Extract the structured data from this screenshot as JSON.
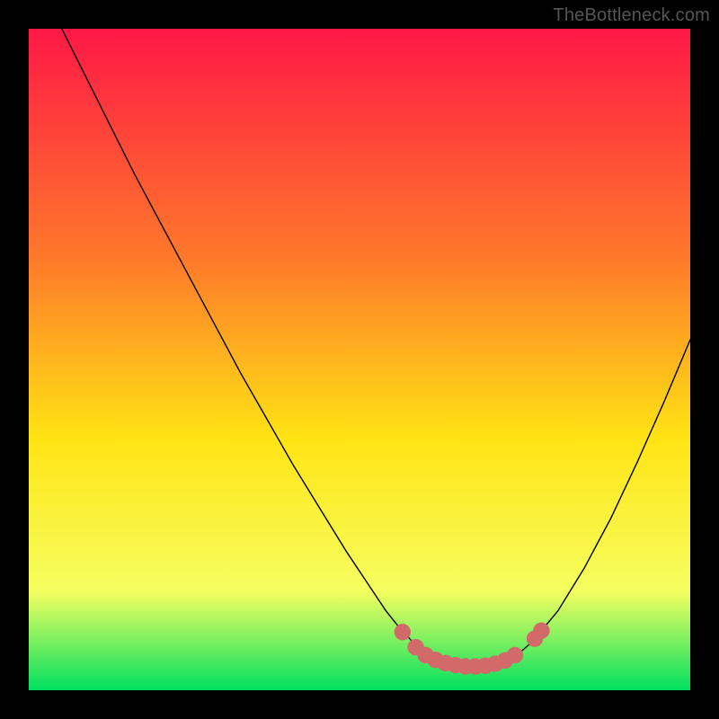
{
  "watermark": "TheBottleneck.com",
  "palette": {
    "gradient_top": "#ff1846",
    "gradient_upper_mid": "#ff7a2a",
    "gradient_mid": "#ffe414",
    "gradient_lower_mid": "#f6ff60",
    "gradient_bottom": "#00e060",
    "frame": "#000000",
    "curve": "#000000",
    "marker": "#d26a6a"
  },
  "chart_data": {
    "type": "line",
    "title": "",
    "xlabel": "",
    "ylabel": "",
    "xlim": [
      0,
      100
    ],
    "ylim": [
      0,
      100
    ],
    "x": [
      5,
      8,
      12,
      16,
      20,
      24,
      28,
      32,
      36,
      40,
      44,
      48,
      52,
      54,
      56,
      58.5,
      60,
      62,
      64,
      66,
      68,
      70,
      72,
      74,
      76,
      80,
      84,
      88,
      92,
      96,
      100
    ],
    "values": [
      100,
      94,
      86,
      78,
      70.5,
      63,
      55.5,
      48,
      41,
      34,
      27.5,
      21,
      15,
      12,
      9.5,
      6.8,
      5.5,
      4.5,
      3.8,
      3.5,
      3.5,
      3.7,
      4.3,
      5.5,
      7.2,
      12,
      18.5,
      26,
      34.5,
      43.5,
      53
    ],
    "series": [
      {
        "name": "bottleneck-curve",
        "color": "curve"
      }
    ],
    "markers": {
      "name": "optimal-zone",
      "color": "marker",
      "points": [
        {
          "x": 56.5,
          "y": 8.8
        },
        {
          "x": 58.5,
          "y": 6.5
        },
        {
          "x": 60.0,
          "y": 5.3
        },
        {
          "x": 61.5,
          "y": 4.6
        },
        {
          "x": 63.0,
          "y": 4.1
        },
        {
          "x": 64.5,
          "y": 3.8
        },
        {
          "x": 66.0,
          "y": 3.6
        },
        {
          "x": 67.5,
          "y": 3.6
        },
        {
          "x": 69.0,
          "y": 3.7
        },
        {
          "x": 70.5,
          "y": 4.0
        },
        {
          "x": 72.0,
          "y": 4.5
        },
        {
          "x": 73.5,
          "y": 5.3
        },
        {
          "x": 76.5,
          "y": 7.8
        },
        {
          "x": 77.5,
          "y": 9.0
        }
      ]
    }
  }
}
